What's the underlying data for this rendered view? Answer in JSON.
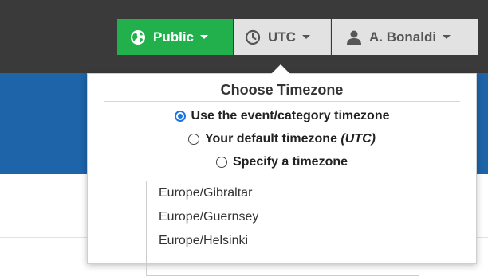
{
  "header": {
    "public_button": {
      "label": "Public",
      "icon": "globe-icon"
    },
    "timezone_button": {
      "label": "UTC",
      "icon": "clock-icon"
    },
    "user_button": {
      "label": "A. Bonaldi",
      "icon": "user-icon"
    }
  },
  "colors": {
    "topbar": "#3a3a3a",
    "public_green": "#21b04b",
    "blue_band": "#1d64a8",
    "radio_accent": "#1a73e8"
  },
  "timezone_popover": {
    "title": "Choose Timezone",
    "options": [
      {
        "label": "Use the event/category timezone",
        "selected": true
      },
      {
        "label_prefix": "Your default timezone ",
        "label_suffix": "(UTC)",
        "selected": false
      },
      {
        "label": "Specify a timezone",
        "selected": false
      }
    ],
    "timezone_list": [
      "Europe/Gibraltar",
      "Europe/Guernsey",
      "Europe/Helsinki"
    ]
  }
}
